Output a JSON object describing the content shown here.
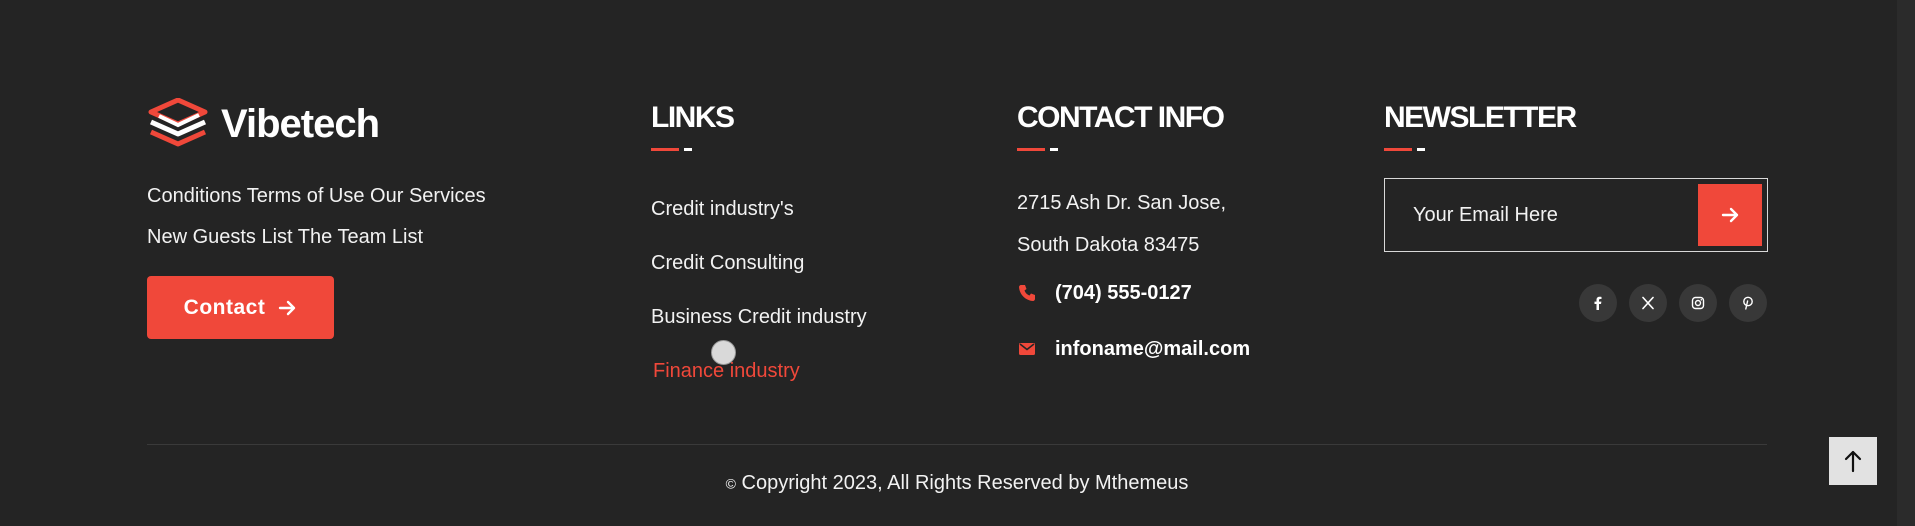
{
  "brand": {
    "name": "Vibetech",
    "links_line1": "Conditions Terms of Use Our Services",
    "links_line2": "New Guests List The Team List",
    "contact_label": "Contact"
  },
  "links": {
    "title": "LINKS",
    "items": [
      "Credit industry's",
      "Credit Consulting",
      "Business Credit industry",
      "Finance industry"
    ],
    "active_index": 3
  },
  "contact_info": {
    "title": "CONTACT INFO",
    "address_line1": "2715 Ash Dr. San Jose,",
    "address_line2": "South Dakota 83475",
    "phone": "(704) 555-0127",
    "email": "infoname@mail.com"
  },
  "newsletter": {
    "title": "NEWSLETTER",
    "email_placeholder": "Your Email Here",
    "social_icons": [
      "facebook-icon",
      "x-icon",
      "instagram-icon",
      "pinterest-icon"
    ]
  },
  "footer": {
    "copyright_symbol": "©",
    "copyright_text": "Copyright 2023, All Rights Reserved by Mthemeus"
  },
  "colors": {
    "background": "#242424",
    "accent": "#f0483a",
    "text": "#ffffff"
  }
}
